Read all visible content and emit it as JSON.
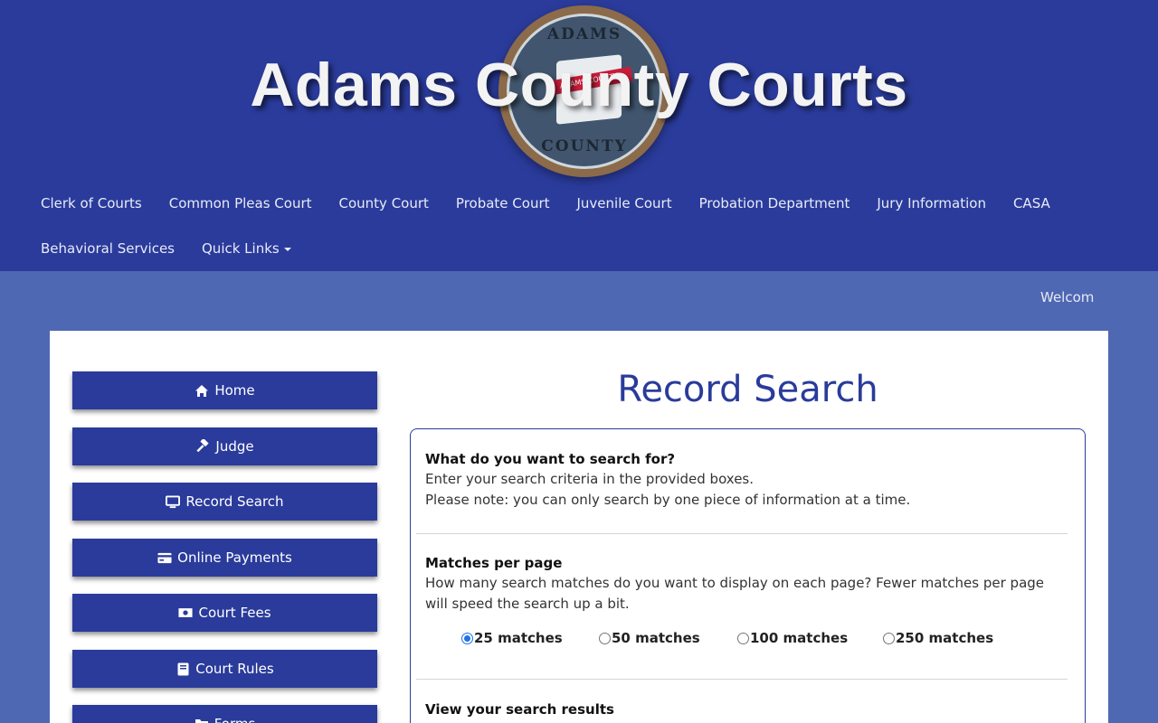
{
  "header": {
    "site_title": "Adams County Courts",
    "seal": {
      "top_text": "ADAMS",
      "bottom_text": "COUNTY",
      "ribbon_text": "ADAMS COUNTY"
    }
  },
  "nav": {
    "row1": [
      "Clerk of Courts",
      "Common Pleas Court",
      "County Court",
      "Probate Court",
      "Juvenile Court",
      "Probation Department",
      "Jury Information",
      "CASA"
    ],
    "row2": [
      "Behavioral Services",
      "Quick Links"
    ]
  },
  "marquee": "Welcom",
  "sidebar": {
    "home": "Home",
    "judge": "Judge",
    "record_search": "Record Search",
    "online_payments": "Online Payments",
    "court_fees": "Court Fees",
    "court_rules": "Court Rules",
    "forms": "Forms"
  },
  "main": {
    "title": "Record Search",
    "what_heading": "What do you want to search for?",
    "what_line1": "Enter your search criteria in the provided boxes.",
    "what_line2": "Please note: you can only search by one piece of information at a time.",
    "matches_heading": "Matches per page",
    "matches_text": "How many search matches do you want to display on each page? Fewer matches per page will speed the search up a bit.",
    "options": [
      "25 matches",
      "50 matches",
      "100 matches",
      "250 matches"
    ],
    "selected_option": "25 matches",
    "results_heading": "View your search results"
  },
  "colors": {
    "header_bg": "#2a3b9b",
    "page_bg": "#4f68b3",
    "button_bg": "#2a3b9b",
    "accent": "#2a3b9b"
  }
}
